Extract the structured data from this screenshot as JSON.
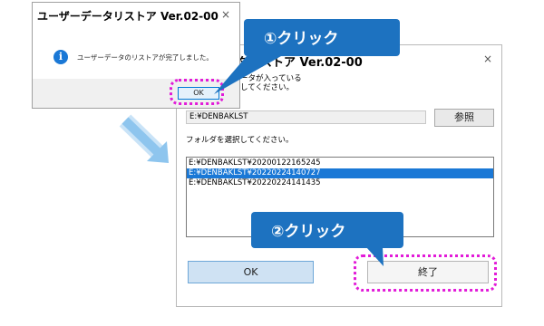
{
  "dialog1": {
    "title": "ユーザーデータリストア Ver.02-00",
    "message": "ユーザーデータのリストアが完了しました。",
    "ok_label": "OK",
    "close_glyph": "×"
  },
  "dialog2": {
    "title_partial": "タリストア Ver.02-00",
    "close_glyph": "×",
    "desc_line1": "ータが入っている",
    "desc_line2": "してください。",
    "path_value": "E:¥DENBAKLST",
    "browse_label": "参照",
    "select_prompt": "フォルダを選択してください。",
    "folders": [
      "E:¥DENBAKLST¥20200122165245",
      "E:¥DENBAKLST¥20220224140727",
      "E:¥DENBAKLST¥20220224141435"
    ],
    "selected_index": 1,
    "ok_label": "OK",
    "end_label": "終了"
  },
  "callouts": {
    "step1": "①クリック",
    "step2": "②クリック"
  },
  "colors": {
    "callout": "#1d72c0",
    "highlight": "#e21bd8",
    "selection": "#1a78d6",
    "info_icon": "#1a78d6",
    "arrow": "#8ec5ee"
  }
}
